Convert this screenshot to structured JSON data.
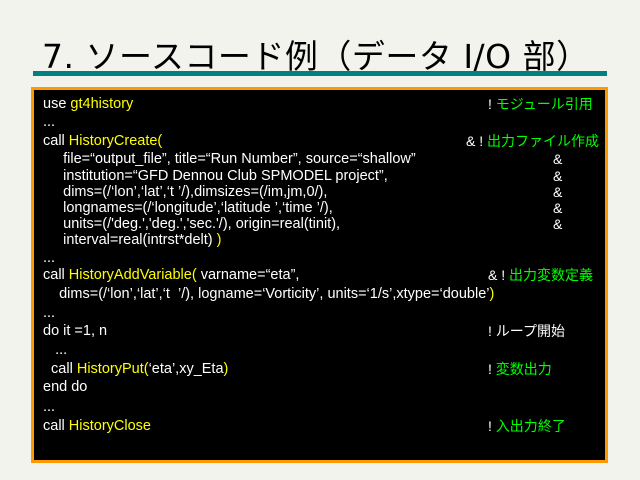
{
  "title": "7. ソースコード例（データ I/O 部）",
  "colors": {
    "text": "#ffffff",
    "keyword": "#ffff00",
    "comment": "#00ff00",
    "border": "#ff9900",
    "rule": "#008080"
  },
  "lines": [
    {
      "segs": [
        {
          "t": "use ",
          "c": "#ffffff"
        },
        {
          "t": "gt4history",
          "c": "#ffff00"
        }
      ],
      "comment": [
        {
          "t": "! ",
          "c": "#ffffff"
        },
        {
          "t": "モジュール引用",
          "c": "#00ff00"
        }
      ]
    },
    {
      "segs": [
        {
          "t": "...",
          "c": "#ffffff"
        }
      ]
    },
    {
      "segs": [
        {
          "t": "call ",
          "c": "#ffffff"
        },
        {
          "t": "HistoryCreate(",
          "c": "#ffff00"
        }
      ],
      "comment": [
        {
          "t": "& ! ",
          "c": "#ffffff"
        },
        {
          "t": "出力ファイル作成",
          "c": "#00ff00"
        }
      ]
    },
    {
      "segs": [
        {
          "t": "     file=“output_file”, title=“Run Number”, source=“shallow”",
          "c": "#ffffff"
        }
      ],
      "amp": "&"
    },
    {
      "segs": [
        {
          "t": "     institution=“GFD Dennou Club SPMODEL project”,",
          "c": "#ffffff"
        }
      ],
      "amp": "&"
    },
    {
      "segs": [
        {
          "t": "     dims=(/‘lon’,‘lat’,‘t ’/),dimsizes=(/im,jm,0/),",
          "c": "#ffffff"
        }
      ],
      "amp": "&"
    },
    {
      "segs": [
        {
          "t": "     longnames=(/‘longitude’,‘latitude ’,‘time ’/),",
          "c": "#ffffff"
        }
      ],
      "amp": "&"
    },
    {
      "segs": [
        {
          "t": "     units=(/'deg.','deg.','sec.'/), origin=real(tinit),",
          "c": "#ffffff"
        }
      ],
      "amp": "&"
    },
    {
      "segs": [
        {
          "t": "     interval=real(intrst*delt) ",
          "c": "#ffffff"
        },
        {
          "t": ")",
          "c": "#ffff00"
        }
      ]
    },
    {
      "segs": [
        {
          "t": "...",
          "c": "#ffffff"
        }
      ]
    },
    {
      "segs": [
        {
          "t": "call ",
          "c": "#ffffff"
        },
        {
          "t": "HistoryAddVariable(",
          "c": "#ffff00"
        },
        {
          "t": " varname=“eta”,",
          "c": "#ffffff"
        }
      ],
      "comment": [
        {
          "t": "& ! ",
          "c": "#ffffff"
        },
        {
          "t": "出力変数定義",
          "c": "#00ff00"
        }
      ]
    },
    {
      "segs": [
        {
          "t": "    dims=(/‘lon’,‘lat’,‘t  ’/), logname=‘Vorticity’, units=‘1/s’,xtype=‘double’",
          "c": "#ffffff"
        },
        {
          "t": ")",
          "c": "#ffff00"
        }
      ]
    },
    {
      "segs": [
        {
          "t": "...",
          "c": "#ffffff"
        }
      ]
    },
    {
      "segs": [
        {
          "t": "do it =1, n",
          "c": "#ffffff"
        }
      ],
      "comment": [
        {
          "t": "! ",
          "c": "#ffffff"
        },
        {
          "t": "ループ開始",
          "c": "#ffffff"
        }
      ]
    },
    {
      "segs": [
        {
          "t": "   ...",
          "c": "#ffffff"
        }
      ]
    },
    {
      "segs": [
        {
          "t": "  call ",
          "c": "#ffffff"
        },
        {
          "t": "HistoryPut(",
          "c": "#ffff00"
        },
        {
          "t": "‘eta’,xy_Eta",
          "c": "#ffffff"
        },
        {
          "t": ")",
          "c": "#ffff00"
        }
      ],
      "comment": [
        {
          "t": "! ",
          "c": "#ffffff"
        },
        {
          "t": "変数出力",
          "c": "#00ff00"
        }
      ]
    },
    {
      "segs": [
        {
          "t": "end do",
          "c": "#ffffff"
        }
      ]
    },
    {
      "segs": [
        {
          "t": "...",
          "c": "#ffffff"
        }
      ]
    },
    {
      "segs": [
        {
          "t": "call ",
          "c": "#ffffff"
        },
        {
          "t": "HistoryClose",
          "c": "#ffff00"
        }
      ],
      "comment": [
        {
          "t": "! ",
          "c": "#ffffff"
        },
        {
          "t": "入出力終了",
          "c": "#00ff00"
        }
      ]
    }
  ]
}
